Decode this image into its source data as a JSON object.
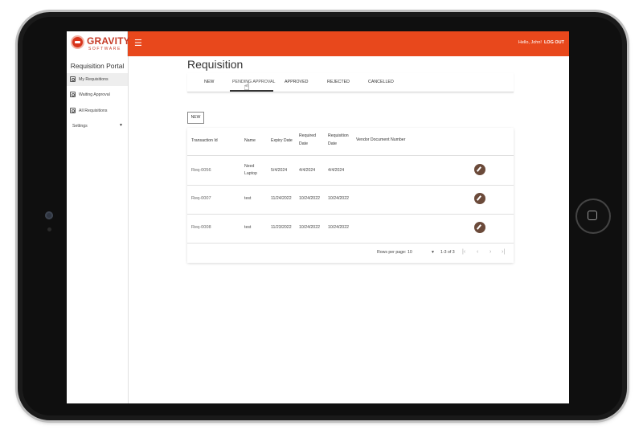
{
  "app": {
    "logo_title": "GRAVITY",
    "logo_subtitle": "SOFTWARE",
    "menu_icon": "hamburger-icon",
    "greeting": "Hello, John!",
    "logout": "LOG OUT",
    "accent_color": "#e8481c"
  },
  "sidebar": {
    "title": "Requisition Portal",
    "items": [
      {
        "label": "My Requisitions",
        "icon": "requisition-icon"
      },
      {
        "label": "Waiting Approval",
        "icon": "requisition-icon"
      },
      {
        "label": "All Requisitions",
        "icon": "requisition-icon"
      },
      {
        "label": "Settings",
        "icon": "chevron-down-icon"
      }
    ]
  },
  "main": {
    "title": "Requisition",
    "tabs": [
      {
        "label": "NEW"
      },
      {
        "label": "PENDING APPROVAL"
      },
      {
        "label": "APPROVED"
      },
      {
        "label": "REJECTED"
      },
      {
        "label": "CANCELLED"
      }
    ],
    "active_tab": "PENDING APPROVAL",
    "new_button": "NEW"
  },
  "table": {
    "headers": {
      "transaction_id": "Transaction Id",
      "name": "Name",
      "expiry_date": "Expiry Date",
      "required_date_1": "Required",
      "required_date_2": "Date",
      "requisition_date_1": "Requisition",
      "requisition_date_2": "Date",
      "vendor_doc": "Vendor Document Number"
    },
    "rows": [
      {
        "id": "Req-0056",
        "name_1": "Need",
        "name_2": "Laptop",
        "expiry": "5/4/2024",
        "required": "4/4/2024",
        "requisition": "4/4/2024",
        "vendor": ""
      },
      {
        "id": "Req-0007",
        "name_1": "test",
        "name_2": "",
        "expiry": "11/24/2022",
        "required": "10/24/2022",
        "requisition": "10/24/2022",
        "vendor": ""
      },
      {
        "id": "Req-0008",
        "name_1": "test",
        "name_2": "",
        "expiry": "11/23/2022",
        "required": "10/24/2022",
        "requisition": "10/24/2022",
        "vendor": ""
      }
    ],
    "footer": {
      "rows_per_page_label": "Rows per page:",
      "rows_per_page_value": "10",
      "range": "1-3 of 3"
    }
  }
}
